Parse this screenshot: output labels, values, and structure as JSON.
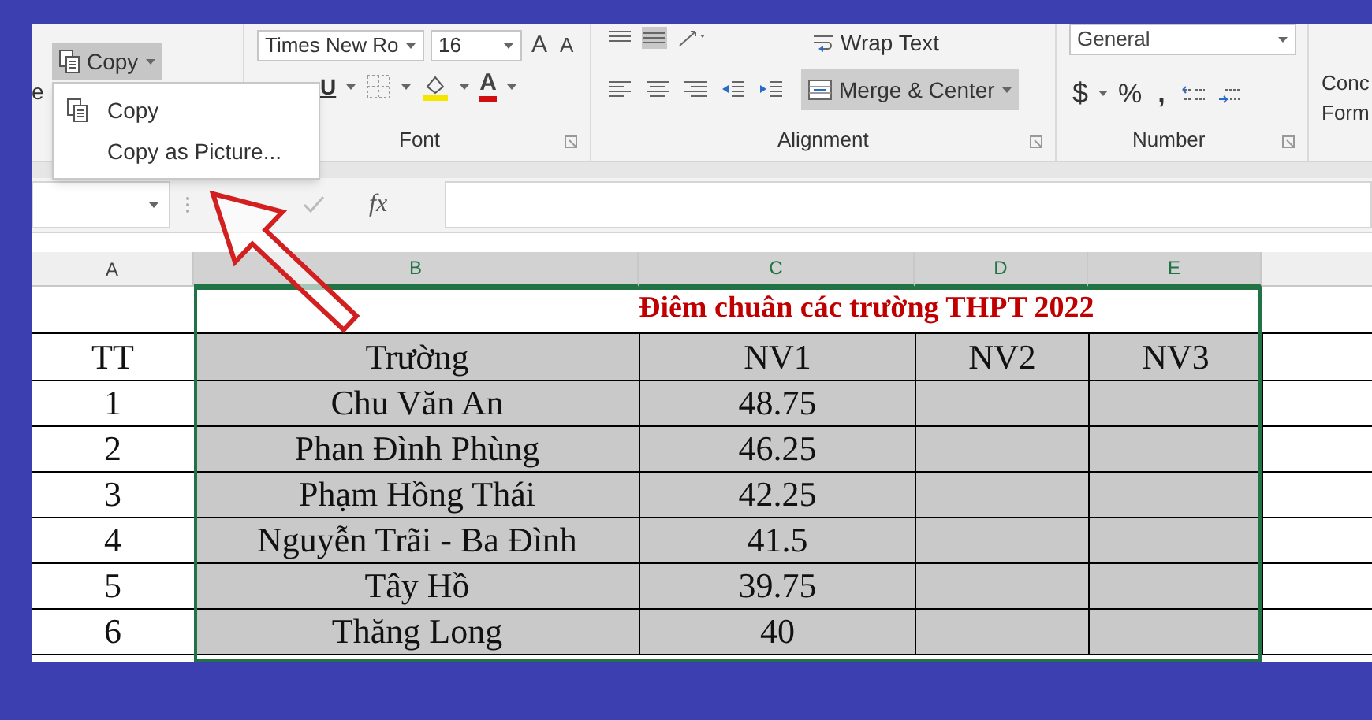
{
  "ribbon": {
    "paste_label": "e",
    "copy_button": {
      "label": "Copy",
      "expanded": true
    },
    "copy_menu": [
      {
        "label": "Copy",
        "kind": "icon"
      },
      {
        "label": "Copy as Picture...",
        "kind": "plain"
      }
    ],
    "font": {
      "name": "Times New Ro",
      "size": "16",
      "grow": "A",
      "shrink": "A",
      "underline": "U",
      "font_color": "A",
      "group": "Font"
    },
    "alignment": {
      "wrap": "Wrap Text",
      "merge": "Merge & Center",
      "group": "Alignment"
    },
    "number": {
      "format": "General",
      "currency": "$",
      "percent": "%",
      "comma": ",",
      "group": "Number"
    },
    "styles": [
      "Conc",
      "Form"
    ]
  },
  "formula_bar": {
    "fx": "fx"
  },
  "sheet": {
    "columns": [
      {
        "label": "A",
        "selected": false
      },
      {
        "label": "B",
        "selected": true
      },
      {
        "label": "C",
        "selected": true
      },
      {
        "label": "D",
        "selected": true
      },
      {
        "label": "E",
        "selected": true
      }
    ],
    "title": "Điêm chuân các trường THPT 2022",
    "header": [
      "TT",
      "Trường",
      "NV1",
      "NV2",
      "NV3"
    ],
    "rows": [
      [
        "1",
        "Chu Văn An",
        "48.75"
      ],
      [
        "2",
        "Phan Đình Phùng",
        "46.25"
      ],
      [
        "3",
        "Phạm Hồng Thái",
        "42.25"
      ],
      [
        "4",
        "Nguyễn Trãi - Ba Đình",
        "41.5"
      ],
      [
        "5",
        "Tây Hồ",
        "39.75"
      ],
      [
        "6",
        "Thăng Long",
        "40"
      ]
    ]
  }
}
